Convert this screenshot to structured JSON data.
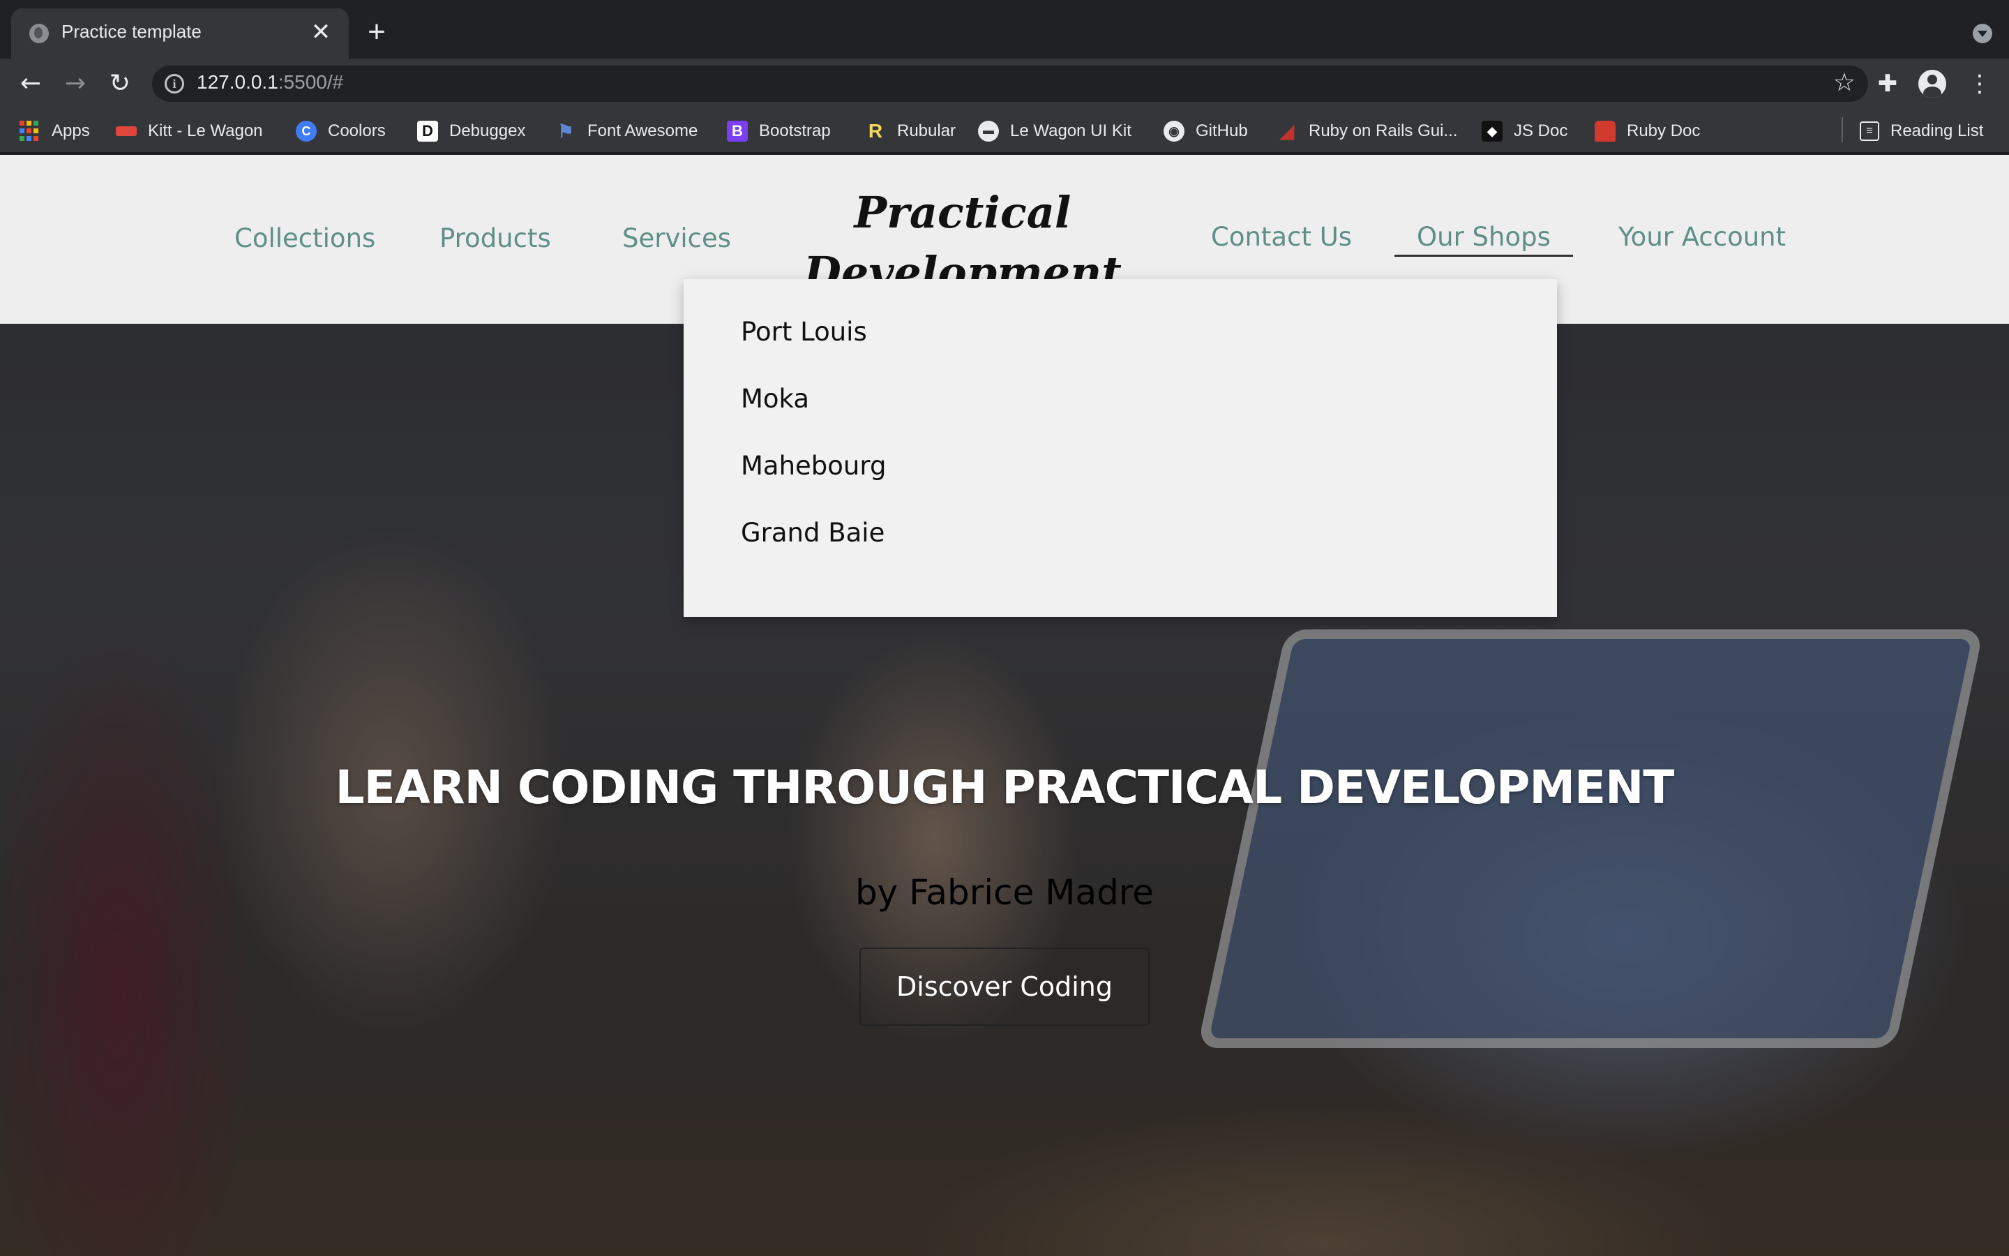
{
  "browser": {
    "tab_title": "Practice template",
    "tab_close": "✕",
    "new_tab": "+",
    "url_host": "127.0.0.1",
    "url_rest": ":5500/#",
    "bookmarks": [
      {
        "label": "Apps",
        "icon": "apps-grid-icon"
      },
      {
        "label": "Kitt - Le Wagon",
        "icon": "le-wagon-icon",
        "color": "#e0473c"
      },
      {
        "label": "Coolors",
        "icon": "coolors-icon",
        "color": "#3f7cf6"
      },
      {
        "label": "Debuggex",
        "icon": "debuggex-icon",
        "color": "#ffffff"
      },
      {
        "label": "Font Awesome",
        "icon": "flag-icon",
        "color": "#5f86d6"
      },
      {
        "label": "Bootstrap",
        "icon": "bootstrap-icon",
        "color": "#7a3ff2"
      },
      {
        "label": "Rubular",
        "icon": "rubular-icon",
        "color": "#f5d95b"
      },
      {
        "label": "Le Wagon UI Kit",
        "icon": "ui-kit-icon",
        "color": "#e8eaed"
      },
      {
        "label": "GitHub",
        "icon": "github-icon",
        "color": "#e8eaed"
      },
      {
        "label": "Ruby on Rails Gui...",
        "icon": "rails-icon",
        "color": "#c5322d"
      },
      {
        "label": "JS Doc",
        "icon": "js-doc-icon",
        "color": "#ffffff"
      },
      {
        "label": "Ruby Doc",
        "icon": "ruby-doc-icon",
        "color": "#d23a2e"
      }
    ],
    "reading_list": "Reading List"
  },
  "nav": {
    "collections": "Collections",
    "products": "Products",
    "services": "Services",
    "brand_line1": "Practical",
    "brand_line2": "Development",
    "contact": "Contact Us",
    "shops": "Our Shops",
    "account": "Your Account"
  },
  "dropdown": {
    "items": [
      "Port Louis",
      "Moka",
      "Mahebourg",
      "Grand Baie"
    ]
  },
  "hero": {
    "title": "LEARN CODING THROUGH PRACTICAL DEVELOPMENT",
    "subtitle": "by Fabrice Madre",
    "button": "Discover Coding"
  },
  "colors": {
    "nav_link": "#5f8f87",
    "navbar_bg": "#eeeeee",
    "dropdown_bg": "#f1f1f1"
  }
}
